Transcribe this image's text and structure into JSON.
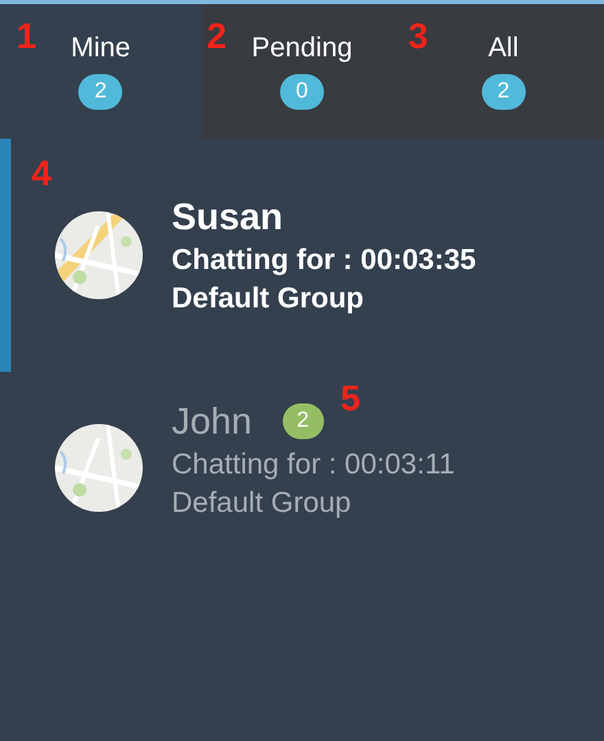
{
  "tabs": [
    {
      "label": "Mine",
      "count": "2",
      "marker": "1",
      "selected": true
    },
    {
      "label": "Pending",
      "count": "0",
      "marker": "2",
      "selected": false
    },
    {
      "label": "All",
      "count": "2",
      "marker": "3",
      "selected": false
    }
  ],
  "chats": [
    {
      "name": "Susan",
      "duration": "Chatting for : 00:03:35",
      "group": "Default Group",
      "marker": "4",
      "selected": true
    },
    {
      "name": "John",
      "unread": "2",
      "duration": "Chatting for : 00:03:11",
      "group": "Default Group",
      "marker": "5",
      "selected": false
    }
  ]
}
